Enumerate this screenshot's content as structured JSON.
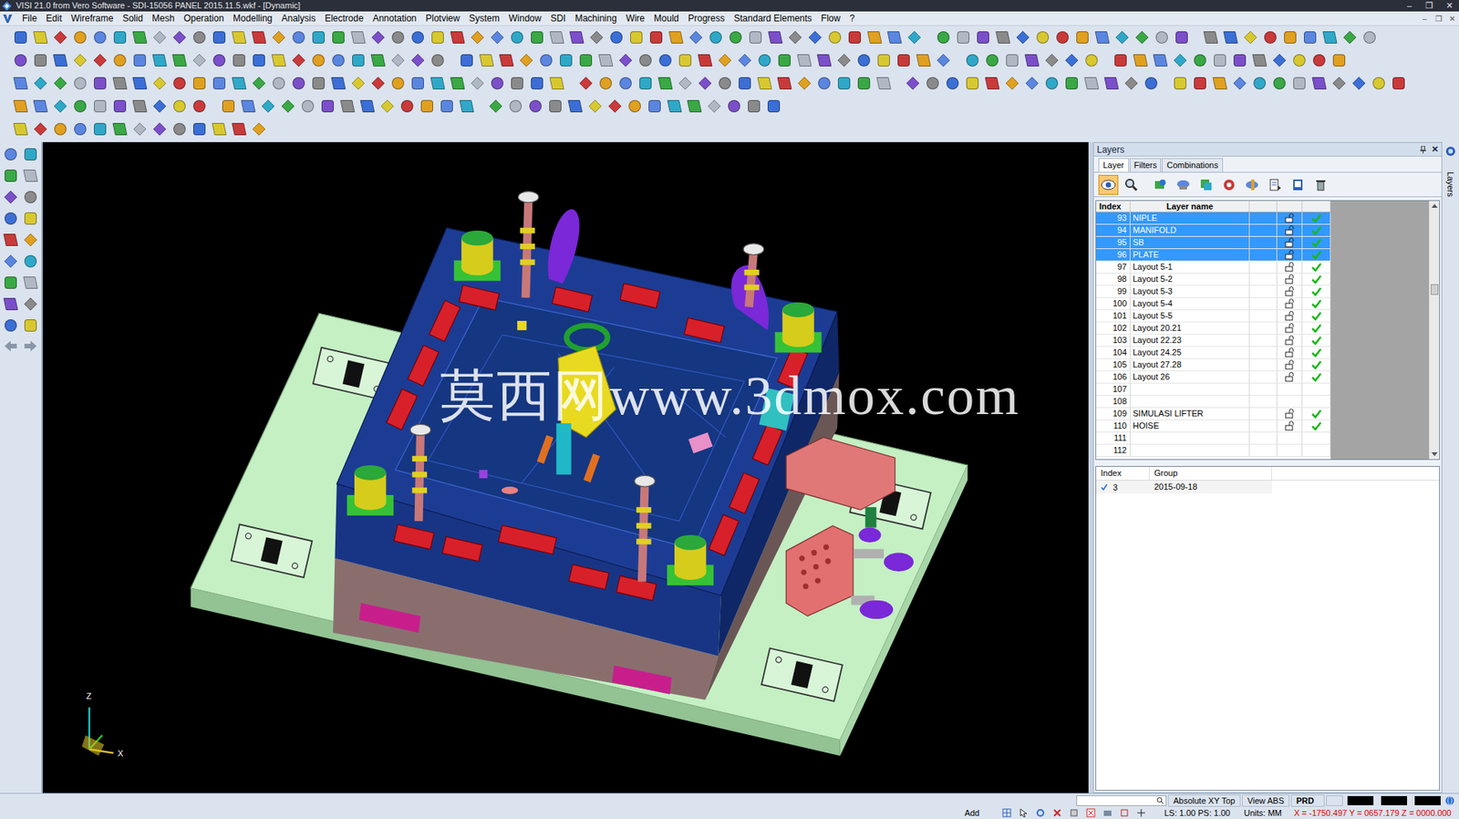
{
  "window": {
    "title": "VISI 21.0 from Vero Software - SDI-15056 PANEL  2015.11.5.wkf - [Dynamic]",
    "controls": [
      "–",
      "❐",
      "✕"
    ]
  },
  "menu": [
    "File",
    "Edit",
    "Wireframe",
    "Solid",
    "Mesh",
    "Operation",
    "Modelling",
    "Analysis",
    "Electrode",
    "Annotation",
    "Plotview",
    "System",
    "Window",
    "SDI",
    "Machining",
    "Wire",
    "Mould",
    "Progress",
    "Standard Elements",
    "Flow",
    "?"
  ],
  "mdi_controls": [
    "–",
    "❐",
    "✕"
  ],
  "viewport": {
    "watermark": "莫西网www.3dmox.com",
    "axes": {
      "z": "Z",
      "x": "X"
    }
  },
  "layers_panel": {
    "title": "Layers",
    "close": "✕",
    "tabs": [
      {
        "label": "Layer",
        "selected": true
      },
      {
        "label": "Filters",
        "selected": false
      },
      {
        "label": "Combinations",
        "selected": false
      }
    ],
    "tools": [
      {
        "selected": true
      },
      {
        "selected": false
      },
      {
        "selected": false
      },
      {
        "selected": false
      },
      {
        "selected": false
      },
      {
        "selected": false
      },
      {
        "selected": false
      },
      {
        "selected": false
      },
      {
        "selected": false
      },
      {
        "selected": false
      }
    ],
    "columns": [
      "Index",
      "Layer name"
    ],
    "rows": [
      {
        "index": "93",
        "name": "NIPLE",
        "selected": true,
        "used": true,
        "locked": false,
        "visible": true
      },
      {
        "index": "94",
        "name": "MANIFOLD",
        "selected": true,
        "used": true,
        "locked": false,
        "visible": true
      },
      {
        "index": "95",
        "name": "SB",
        "selected": true,
        "used": true,
        "locked": false,
        "visible": true
      },
      {
        "index": "96",
        "name": "PLATE",
        "selected": true,
        "used": true,
        "locked": false,
        "visible": true
      },
      {
        "index": "97",
        "name": "Layout 5-1",
        "selected": false,
        "used": true,
        "locked": false,
        "visible": true
      },
      {
        "index": "98",
        "name": "Layout 5-2",
        "selected": false,
        "used": true,
        "locked": false,
        "visible": true
      },
      {
        "index": "99",
        "name": "Layout 5-3",
        "selected": false,
        "used": true,
        "locked": false,
        "visible": true
      },
      {
        "index": "100",
        "name": "Layout 5-4",
        "selected": false,
        "used": true,
        "locked": false,
        "visible": true
      },
      {
        "index": "101",
        "name": "Layout 5-5",
        "selected": false,
        "used": true,
        "locked": false,
        "visible": true
      },
      {
        "index": "102",
        "name": "Layout 20.21",
        "selected": false,
        "used": true,
        "locked": false,
        "visible": true
      },
      {
        "index": "103",
        "name": "Layout 22.23",
        "selected": false,
        "used": true,
        "locked": false,
        "visible": true
      },
      {
        "index": "104",
        "name": "Layout 24.25",
        "selected": false,
        "used": true,
        "locked": false,
        "visible": true
      },
      {
        "index": "105",
        "name": "Layout 27.28",
        "selected": false,
        "used": true,
        "locked": false,
        "visible": true
      },
      {
        "index": "106",
        "name": "Layout 26",
        "selected": false,
        "used": true,
        "locked": false,
        "visible": true
      },
      {
        "index": "107",
        "selected": false,
        "used": false,
        "locked": false,
        "visible": false
      },
      {
        "index": "108",
        "selected": false,
        "used": false,
        "locked": false,
        "visible": false
      },
      {
        "index": "109",
        "name": "SIMULASI LIFTER",
        "selected": false,
        "used": true,
        "locked": false,
        "visible": true
      },
      {
        "index": "110",
        "name": "HOISE",
        "selected": false,
        "used": true,
        "locked": false,
        "visible": true
      },
      {
        "index": "111",
        "selected": false,
        "used": false,
        "locked": false,
        "visible": false
      },
      {
        "index": "112",
        "selected": false,
        "used": false,
        "locked": false,
        "visible": false
      }
    ],
    "groups": {
      "columns": [
        "Index",
        "Group"
      ],
      "rows": [
        {
          "checked": true,
          "index": "3",
          "group": "2015-09-18"
        }
      ]
    }
  },
  "side_tab": "Layers",
  "status_bar": {
    "view": "Absolute XY Top",
    "view_abs": "View ABS",
    "prd": "PRD",
    "mode": "Add",
    "scale": "LS: 1.00 PS: 1.00",
    "units": "Units: MM",
    "coords": "X = -1750.497 Y = 0657.179 Z = 0000.000"
  }
}
